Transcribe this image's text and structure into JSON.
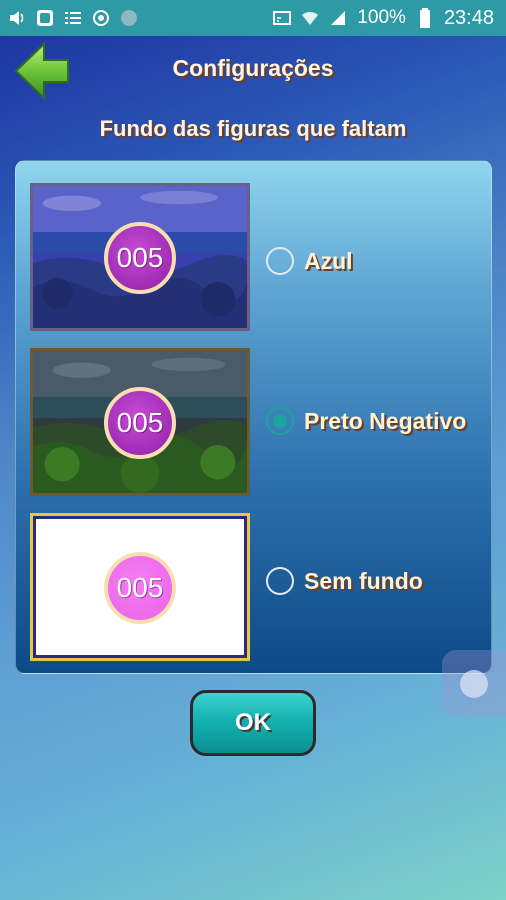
{
  "status_bar": {
    "battery_text": "100%",
    "clock": "23:48",
    "icons": [
      "volume-icon",
      "app-icon",
      "list-icon",
      "sync-icon",
      "dot-icon",
      "cast-icon",
      "wifi-icon",
      "signal-icon",
      "battery-icon"
    ]
  },
  "header": {
    "title": "Configurações",
    "back_icon": "back-arrow-icon"
  },
  "subtitle": "Fundo das figuras que faltam",
  "options": [
    {
      "thumb_label": "005",
      "label": "Azul",
      "checked": false
    },
    {
      "thumb_label": "005",
      "label": "Preto Negativo",
      "checked": true
    },
    {
      "thumb_label": "005",
      "label": "Sem fundo",
      "checked": false
    }
  ],
  "ok_button": {
    "label": "OK"
  },
  "colors": {
    "accent": "#1aa59a",
    "status_bar": "#2e9aa5",
    "badge_purple": "#a02db5",
    "badge_pink": "#ee6aec"
  }
}
